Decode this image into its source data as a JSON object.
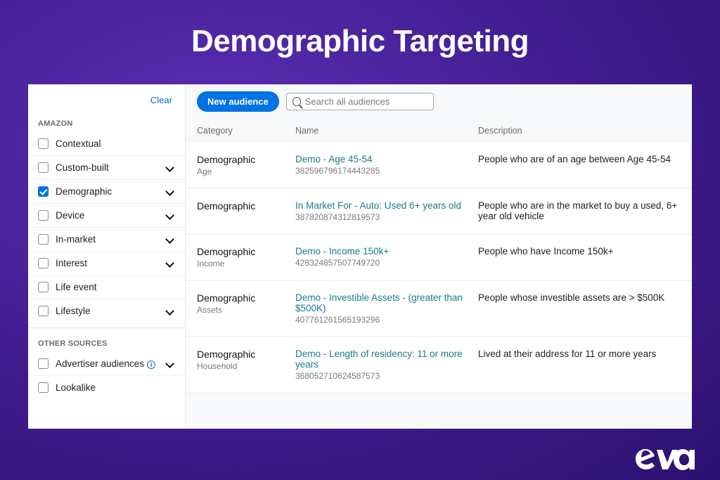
{
  "page_title": "Demographic Targeting",
  "sidebar": {
    "clear": "Clear",
    "section1": "AMAZON",
    "section2": "OTHER SOURCES",
    "items": [
      {
        "label": "Contextual",
        "checked": false,
        "expandable": false
      },
      {
        "label": "Custom-built",
        "checked": false,
        "expandable": true
      },
      {
        "label": "Demographic",
        "checked": true,
        "expandable": true
      },
      {
        "label": "Device",
        "checked": false,
        "expandable": true
      },
      {
        "label": "In-market",
        "checked": false,
        "expandable": true
      },
      {
        "label": "Interest",
        "checked": false,
        "expandable": true
      },
      {
        "label": "Life event",
        "checked": false,
        "expandable": false
      },
      {
        "label": "Lifestyle",
        "checked": false,
        "expandable": true
      }
    ],
    "other": [
      {
        "label": "Advertiser audiences",
        "info": true,
        "expandable": true
      },
      {
        "label": "Lookalike",
        "info": false,
        "expandable": false
      }
    ]
  },
  "toolbar": {
    "new_audience": "New audience",
    "search_placeholder": "Search all audiences"
  },
  "table": {
    "headers": {
      "category": "Category",
      "name": "Name",
      "description": "Description"
    },
    "rows": [
      {
        "cat": "Demographic",
        "sub": "Age",
        "name": "Demo - Age 45-54",
        "id": "382596796174443285",
        "desc": "People who are of an age between Age 45-54"
      },
      {
        "cat": "Demographic",
        "sub": "",
        "name": "In Market For - Auto: Used 6+ years old",
        "id": "387820874312819573",
        "desc": "People who are in the market to buy a used, 6+ year old vehicle"
      },
      {
        "cat": "Demographic",
        "sub": "Income",
        "name": "Demo - Income 150k+",
        "id": "428324857507749720",
        "desc": "People who have Income 150k+"
      },
      {
        "cat": "Demographic",
        "sub": "Assets",
        "name": "Demo - Investible Assets - (greater than $500K)",
        "id": "407761261565193296",
        "desc": "People whose investible assets are > $500K"
      },
      {
        "cat": "Demographic",
        "sub": "Household",
        "name": "Demo - Length of residency: 11 or more years",
        "id": "368052710624587573",
        "desc": "Lived at their address for 11 or more years"
      }
    ]
  },
  "brand": "eva"
}
